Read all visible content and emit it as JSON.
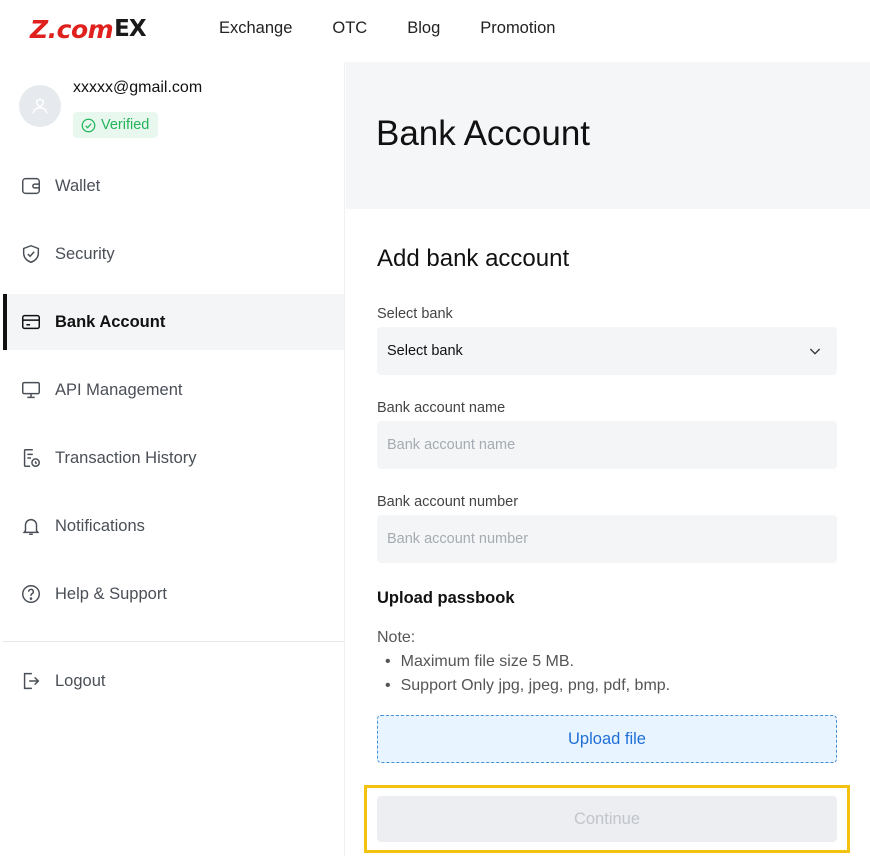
{
  "brand": {
    "logo_main": "Z.com",
    "logo_suffix": "EX",
    "logo_color": "#e0201c"
  },
  "nav": [
    "Exchange",
    "OTC",
    "Blog",
    "Promotion"
  ],
  "profile": {
    "email": "xxxxx@gmail.com",
    "status": "Verified"
  },
  "menu": [
    {
      "label": "Wallet",
      "icon": "wallet-icon"
    },
    {
      "label": "Security",
      "icon": "shield-icon"
    },
    {
      "label": "Bank Account",
      "icon": "card-icon",
      "active": true
    },
    {
      "label": "API Management",
      "icon": "monitor-icon"
    },
    {
      "label": "Transaction History",
      "icon": "history-icon"
    },
    {
      "label": "Notifications",
      "icon": "bell-icon"
    },
    {
      "label": "Help & Support",
      "icon": "help-icon"
    }
  ],
  "logout": {
    "label": "Logout",
    "icon": "logout-icon"
  },
  "page": {
    "title": "Bank Account"
  },
  "form": {
    "title": "Add bank account",
    "bank_label": "Select bank",
    "bank_value": "Select bank",
    "name_label": "Bank account name",
    "name_placeholder": "Bank account name",
    "number_label": "Bank account number",
    "number_placeholder": "Bank account number",
    "upload_title": "Upload passbook",
    "note_label": "Note:",
    "notes": [
      "Maximum file size 5 MB.",
      "Support Only jpg, jpeg, png, pdf, bmp."
    ],
    "upload_button": "Upload file",
    "continue_button": "Continue"
  },
  "colors": {
    "accent": "#1f6fd6",
    "verified": "#22b55a",
    "highlight": "#f2c20f"
  }
}
